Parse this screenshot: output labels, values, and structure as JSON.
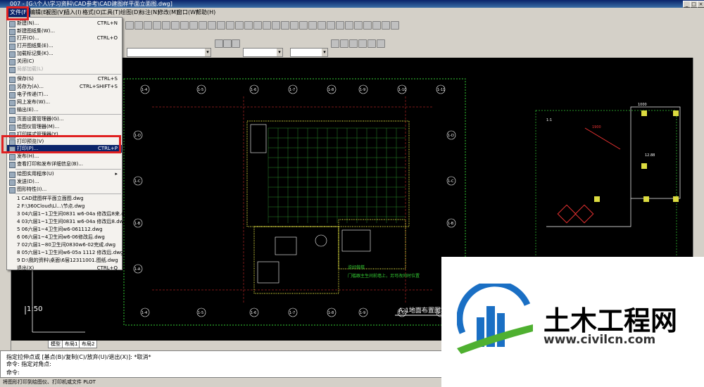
{
  "window": {
    "title": "007 - [G:\\个人\\学习资料\\CAD参考\\CAD建图样平面立面图.dwg]"
  },
  "menubar": [
    {
      "label": "文件(F)"
    },
    {
      "label": "编辑(E)"
    },
    {
      "label": "视图(V)"
    },
    {
      "label": "插入(I)"
    },
    {
      "label": "格式(O)"
    },
    {
      "label": "工具(T)"
    },
    {
      "label": "绘图(D)"
    },
    {
      "label": "标注(N)"
    },
    {
      "label": "修改(M)"
    },
    {
      "label": "窗口(W)"
    },
    {
      "label": "帮助(H)"
    }
  ],
  "file_menu": {
    "items": [
      {
        "label": "新建(N)...",
        "shortcut": "CTRL+N"
      },
      {
        "label": "新建图纸集(W)...",
        "shortcut": ""
      },
      {
        "label": "打开(O)...",
        "shortcut": "CTRL+O"
      },
      {
        "label": "打开图纸集(E)...",
        "shortcut": ""
      },
      {
        "label": "加载标记集(K)...",
        "shortcut": ""
      },
      {
        "label": "关闭(C)",
        "shortcut": ""
      },
      {
        "label": "局部加载(L)",
        "shortcut": "",
        "disabled": true
      },
      {
        "label": "保存(S)",
        "shortcut": "CTRL+S"
      },
      {
        "label": "另存为(A)...",
        "shortcut": "CTRL+SHIFT+S"
      },
      {
        "label": "电子传递(T)...",
        "shortcut": ""
      },
      {
        "label": "网上发布(W)...",
        "shortcut": ""
      },
      {
        "label": "输出(E)...",
        "shortcut": ""
      },
      {
        "label": "页面设置管理器(G)...",
        "shortcut": ""
      },
      {
        "label": "绘图仪管理器(M)...",
        "shortcut": ""
      },
      {
        "label": "打印样式管理器(Y)...",
        "shortcut": ""
      },
      {
        "label": "打印预览(V)",
        "shortcut": ""
      },
      {
        "label": "打印(P)...",
        "shortcut": "CTRL+P",
        "highlight": true
      },
      {
        "label": "发布(H)...",
        "shortcut": ""
      },
      {
        "label": "查看打印和发布详细信息(B)...",
        "shortcut": ""
      },
      {
        "label": "绘图实用程序(U)",
        "shortcut": "▸"
      },
      {
        "label": "发送(D)...",
        "shortcut": ""
      },
      {
        "label": "图形特性(I)...",
        "shortcut": ""
      },
      {
        "label": "1 CAD建图样平面立面图.dwg",
        "shortcut": ""
      },
      {
        "label": "2 F:\\360Cloud\\Ll...\\节点.dwg",
        "shortcut": ""
      },
      {
        "label": "3 04六层1~1卫生间0831 w6-04a 修改后8来.dwg",
        "shortcut": ""
      },
      {
        "label": "4 03六层1~1卫生间0831 w6-04a 修改后8.dwg",
        "shortcut": ""
      },
      {
        "label": "5 06六层1~4卫生间w6-061112.dwg",
        "shortcut": ""
      },
      {
        "label": "6 06六层1~4卫生间w6-06修改后.dwg",
        "shortcut": ""
      },
      {
        "label": "7 02六层1~80卫生间0830w6-02完成.dwg",
        "shortcut": ""
      },
      {
        "label": "8 05六层1~1卫生间w6-05a 1112 修改后.dwg",
        "shortcut": ""
      },
      {
        "label": "9 D:\\我的资料\\桌面\\6层12311001.图纸.dwg",
        "shortcut": ""
      },
      {
        "label": "退出(X)",
        "shortcut": "CTRL+Q"
      }
    ]
  },
  "drawing": {
    "axis_labels_top": [
      "1-4",
      "1-5",
      "1-6",
      "1-7",
      "1-8",
      "1-9",
      "1-10",
      "1-11"
    ],
    "axis_labels_side": [
      "1-D",
      "1-C",
      "1-B",
      "1-A"
    ],
    "title_block": "A-1地面布置图",
    "scale_label": "1:50",
    "green_note_line1": "说好做楼",
    "green_note_line2": "门槛跟主生间前墙上，另可改同时位置",
    "dim_texts": [
      "1900",
      "1000",
      "12.88",
      "1:1"
    ]
  },
  "layout_tabs": [
    "模型",
    "布局1",
    "布局2"
  ],
  "command": {
    "line1": "指定拉伸点或 [基点(B)/复制(C)/放弃(U)/退出(X)]: *取消*",
    "line2": "命令: 指定对角点:",
    "line3": "命令:"
  },
  "status": {
    "text": "将图形打印到绘图仪、打印机或文件   PLOT"
  },
  "watermark": {
    "name": "土木工程网",
    "url": "www.civilcn.com"
  }
}
